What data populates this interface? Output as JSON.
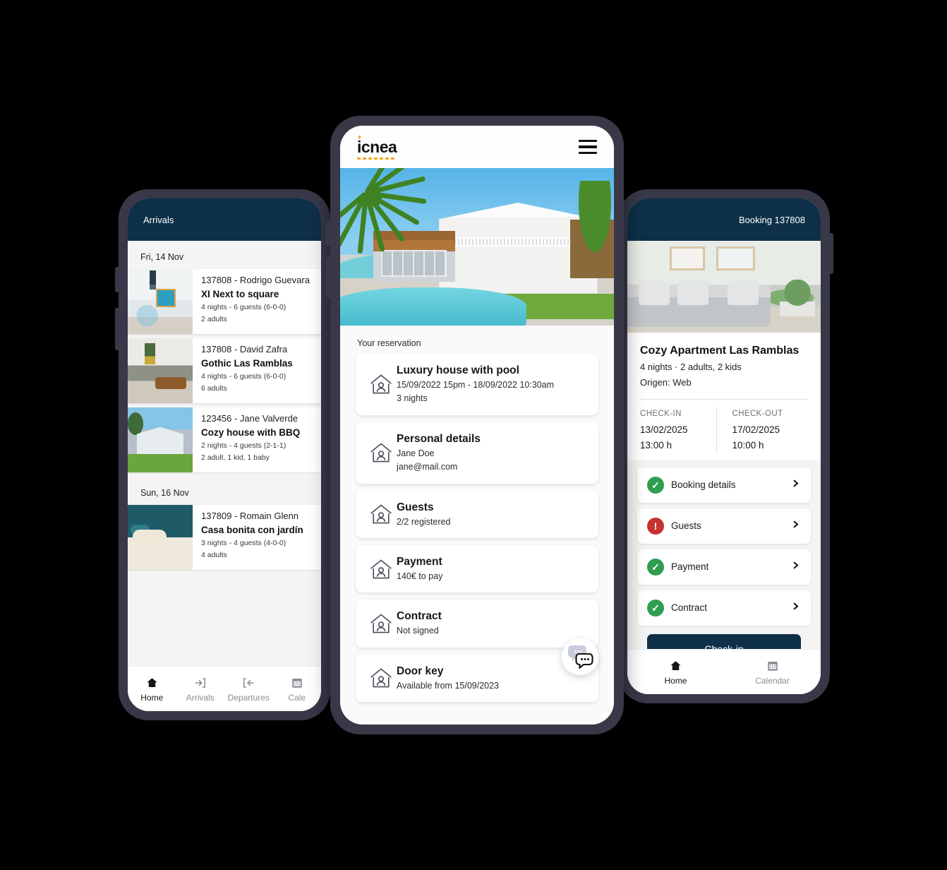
{
  "left_phone": {
    "appbar_title": "Arrivals",
    "groups": [
      {
        "date_label": "Fri, 14 Nov",
        "items": [
          {
            "code": "137808 - Rodrigo Guevara",
            "title": "XI Next to square",
            "meta1": "4 nights - 6 guests (6-0-0)",
            "meta2": "2 adults",
            "thumb": "bedroom-white-photo"
          },
          {
            "code": "137808 - David Zafra",
            "title": "Gothic Las Ramblas",
            "meta1": "4 nights - 6 guests (6-0-0)",
            "meta2": "6 adults",
            "thumb": "livingroom-photo"
          },
          {
            "code": "123456 - Jane Valverde",
            "title": "Cozy house with BBQ",
            "meta1": "2 nights - 4 guests (2-1-1)",
            "meta2": "2 adult, 1 kid, 1 baby",
            "thumb": "house-exterior-photo"
          }
        ]
      },
      {
        "date_label": "Sun, 16 Nov",
        "items": [
          {
            "code": "137809 - Romain Glenn",
            "title": "Casa bonita con jardín",
            "meta1": "3 nights - 4 guests (4-0-0)",
            "meta2": "4 adults",
            "thumb": "bedroom-teal-photo"
          }
        ]
      }
    ],
    "bottom_nav": [
      {
        "label": "Home",
        "icon": "home-icon",
        "active": true
      },
      {
        "label": "Arrivals",
        "icon": "arrivals-arrow-in-icon",
        "active": false
      },
      {
        "label": "Departures",
        "icon": "departures-arrow-out-icon",
        "active": false
      },
      {
        "label": "Cale",
        "icon": "calendar-icon",
        "active": false
      }
    ]
  },
  "center_phone": {
    "logo": "icnea",
    "menu_icon": "hamburger-menu-icon",
    "hero_image": "luxury-house-with-pool-photo",
    "section_label": "Your reservation",
    "cards": [
      {
        "icon": "house-person-icon",
        "title": "Luxury house with pool",
        "line1": "15/09/2022 15pm - 18/09/2022 10:30am",
        "line2": "3 nights"
      },
      {
        "icon": "house-person-icon",
        "title": "Personal details",
        "line1": "Jane Doe",
        "line2": "jane@mail.com"
      },
      {
        "icon": "house-person-icon",
        "title": "Guests",
        "line1": "2/2 registered",
        "line2": ""
      },
      {
        "icon": "house-person-icon",
        "title": "Payment",
        "line1": "140€ to pay",
        "line2": ""
      },
      {
        "icon": "house-person-icon",
        "title": "Contract",
        "line1": "Not signed",
        "line2": ""
      },
      {
        "icon": "house-person-icon",
        "title": "Door key",
        "line1": "Available from 15/09/2023",
        "line2": ""
      }
    ],
    "fab": {
      "icon": "chat-bubbles-icon"
    }
  },
  "right_phone": {
    "appbar_title": "Booking 137808",
    "hero_image": "cozy-apartment-livingroom-photo",
    "property_title": "Cozy Apartment Las Ramblas",
    "property_sub": "4 nights · 2 adults, 2 kids",
    "property_origin": "Origen: Web",
    "checkin": {
      "label": "CHECK-IN",
      "date": "13/02/2025",
      "time": "13:00 h"
    },
    "checkout": {
      "label": "CHECK-OUT",
      "date": "17/02/2025",
      "time": "10:00 h"
    },
    "rows": [
      {
        "label": "Booking details",
        "status": "ok",
        "status_glyph": "✓",
        "chevron": "chevron-right-icon"
      },
      {
        "label": "Guests",
        "status": "warn",
        "status_glyph": "!",
        "chevron": "chevron-right-icon"
      },
      {
        "label": "Payment",
        "status": "ok",
        "status_glyph": "✓",
        "chevron": "chevron-right-icon"
      },
      {
        "label": "Contract",
        "status": "ok",
        "status_glyph": "✓",
        "chevron": "chevron-right-icon"
      }
    ],
    "primary_button": "Check-in",
    "bottom_nav": [
      {
        "label": "Home",
        "icon": "home-icon",
        "active": true
      },
      {
        "label": "Calendar",
        "icon": "calendar-icon",
        "active": false
      }
    ]
  },
  "colors": {
    "appbar_navy": "#0e3048",
    "phone_frame": "#383848",
    "brand_orange": "#f0a91e",
    "status_ok_green": "#2f9e4f",
    "status_warn_red": "#c63232",
    "page_background": "#000000"
  }
}
